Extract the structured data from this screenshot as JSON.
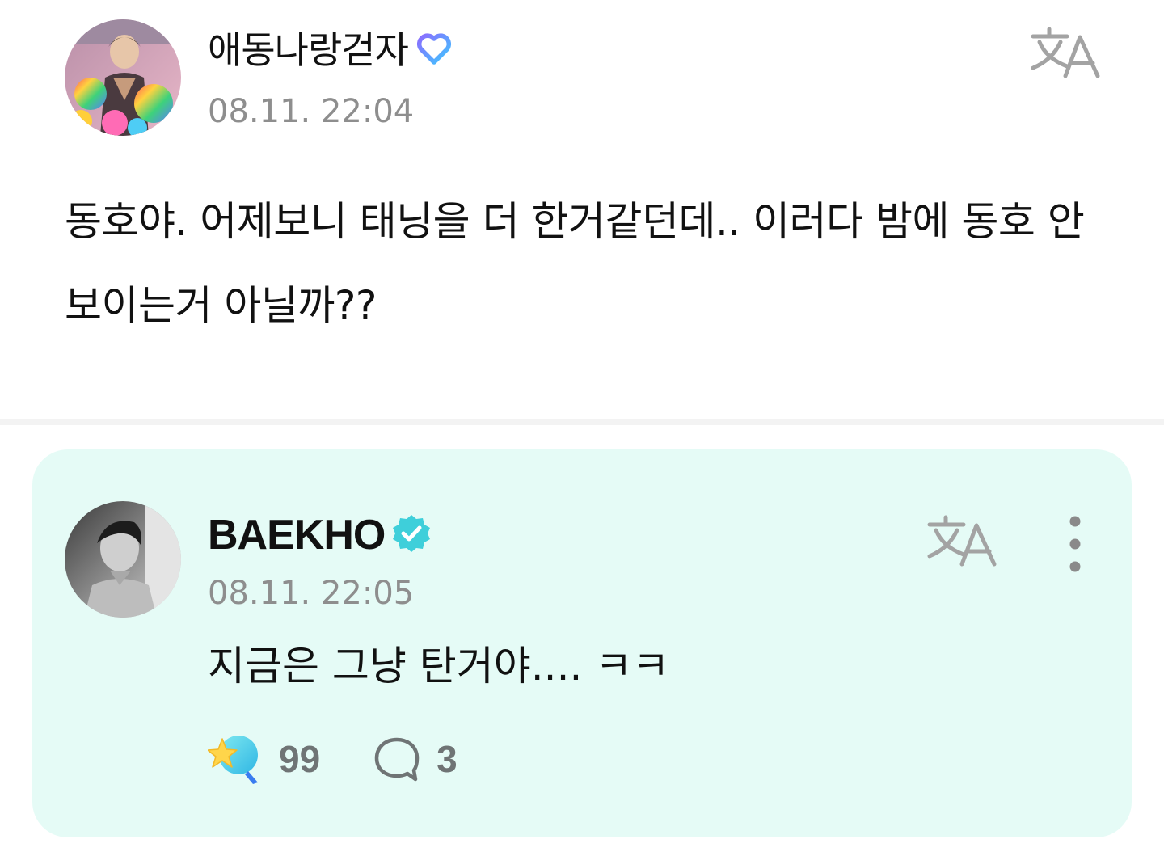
{
  "post": {
    "author": {
      "name": "애동나랑걷자",
      "badge_icon": "fan-heart-badge-icon",
      "avatar": "user-avatar"
    },
    "timestamp": "08.11. 22:04",
    "translate_icon": "translate-icon",
    "body": "동호야. 어제보니 태닝을 더 한거같던데.. 이러다 밤에 동호 안보이는거 아닐까??"
  },
  "reply": {
    "author": {
      "name": "BAEKHO",
      "badge_icon": "verified-artist-badge-icon",
      "avatar": "artist-avatar"
    },
    "timestamp": "08.11. 22:05",
    "translate_icon": "translate-icon",
    "more_icon": "more-vertical-icon",
    "body": "지금은 그냥 탄거야.... ㅋㅋ",
    "reactions": {
      "like_icon": "sparkle-reaction-icon",
      "like_count": "99",
      "comment_icon": "comment-bubble-icon",
      "comment_count": "3"
    },
    "card_color": "#e5fbf6"
  },
  "colors": {
    "text": "#111111",
    "muted": "#8e8e8e",
    "verified": "#3ecfda",
    "fan_badge_start": "#8b6cff",
    "fan_badge_end": "#3ec7ff"
  }
}
